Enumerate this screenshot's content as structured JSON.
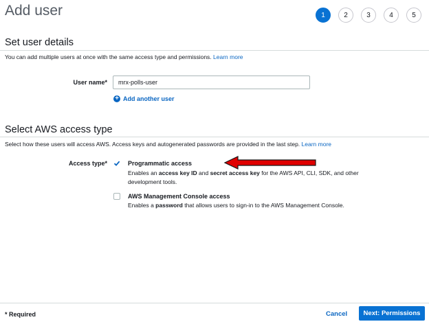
{
  "page": {
    "title": "Add user"
  },
  "steps": [
    "1",
    "2",
    "3",
    "4",
    "5"
  ],
  "user_details": {
    "title": "Set user details",
    "description": "You can add multiple users at once with the same access type and permissions.",
    "learn_more": "Learn more",
    "user_name_label": "User name*",
    "user_name_value": "mrx-polls-user",
    "add_another": "Add another user"
  },
  "access_type": {
    "title": "Select AWS access type",
    "description": "Select how these users will access AWS. Access keys and autogenerated passwords are provided in the last step.",
    "learn_more": "Learn more",
    "label": "Access type*",
    "programmatic": {
      "title": "Programmatic access",
      "desc_parts": [
        "Enables an ",
        "access key ID",
        " and ",
        "secret access key",
        " for the AWS API, CLI, SDK, and other development tools."
      ],
      "checked": true
    },
    "console": {
      "title": "AWS Management Console access",
      "desc_parts": [
        "Enables a ",
        "password",
        " that allows users to sign-in to the AWS Management Console."
      ],
      "checked": false
    }
  },
  "footer": {
    "required": "* Required",
    "cancel": "Cancel",
    "next": "Next: Permissions"
  },
  "colors": {
    "primary": "#0972d3",
    "link": "#0a66c2",
    "annotation_arrow": "#e00000"
  },
  "icons": {
    "add": "plus-circle-icon",
    "check": "check-icon",
    "annotation": "red-arrow-icon"
  }
}
